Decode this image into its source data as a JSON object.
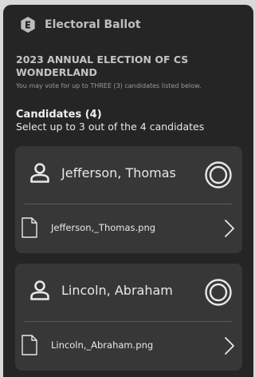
{
  "header": {
    "title": "Electoral Ballot",
    "icon": "ballot-e-icon"
  },
  "election": {
    "title": "2023 ANNUAL ELECTION OF CS WONDERLAND",
    "instructions": "You may vote for up to THREE (3) candidates listed below."
  },
  "candidates_section": {
    "heading": "Candidates (4)",
    "subheading": "Select up to 3 out of the 4 candidates"
  },
  "candidates": [
    {
      "name": "Jefferson, Thomas",
      "file": "Jefferson,_Thomas.png",
      "selected": false
    },
    {
      "name": "Lincoln, Abraham",
      "file": "Lincoln,_Abraham.png",
      "selected": false
    }
  ],
  "colors": {
    "panel": "#252525",
    "card": "#373737",
    "text": "#e8e8e8"
  }
}
